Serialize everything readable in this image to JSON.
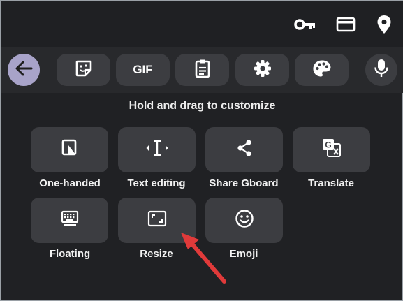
{
  "status_icons": [
    "key-icon",
    "card-icon",
    "location-pin-icon"
  ],
  "toolbar": {
    "back_icon": "arrow-back-icon",
    "gif_label": "GIF",
    "buttons": [
      "sticker-icon",
      "gif-button",
      "clipboard-icon",
      "settings-icon",
      "palette-icon"
    ],
    "mic_icon": "mic-icon"
  },
  "hint": "Hold and drag to customize",
  "tiles": [
    {
      "label": "One-handed",
      "icon": "one-handed-icon"
    },
    {
      "label": "Text editing",
      "icon": "text-cursor-icon"
    },
    {
      "label": "Share Gboard",
      "icon": "share-icon"
    },
    {
      "label": "Translate",
      "icon": "translate-icon"
    },
    {
      "label": "Floating",
      "icon": "keyboard-icon"
    },
    {
      "label": "Resize",
      "icon": "resize-icon"
    },
    {
      "label": "Emoji",
      "icon": "emoji-icon"
    }
  ],
  "colors": {
    "background": "#202124",
    "tile": "#3c3d41",
    "back_button": "#a8a3c9",
    "annotation_arrow": "#e03a3a"
  }
}
